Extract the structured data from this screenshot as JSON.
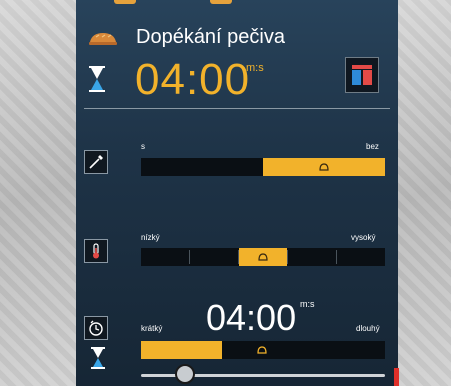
{
  "header": {
    "program_title": "Dopékání pečiva",
    "time": "04:00",
    "time_unit": "m:s"
  },
  "browning": {
    "label_left": "s",
    "label_right": "bez",
    "level_fraction": 0.5
  },
  "temperature": {
    "label_left": "nízký",
    "label_right": "vysoký",
    "selected_segment": 3,
    "segments": 5
  },
  "duration": {
    "time": "04:00",
    "time_unit": "m:s",
    "label_left": "krátký",
    "label_right": "dlouhý",
    "level_fraction": 0.33,
    "slider_fraction": 0.2
  },
  "colors": {
    "accent": "#f2b22b",
    "panel_bg": "#1e3347",
    "track_bg": "#0a0f14"
  },
  "icons": {
    "program": "bread-icon",
    "timer": "hourglass-icon",
    "mode": "mode-toggle-icon",
    "browning": "probe-icon",
    "temperature": "thermometer-icon",
    "duration": "clock-icon"
  }
}
